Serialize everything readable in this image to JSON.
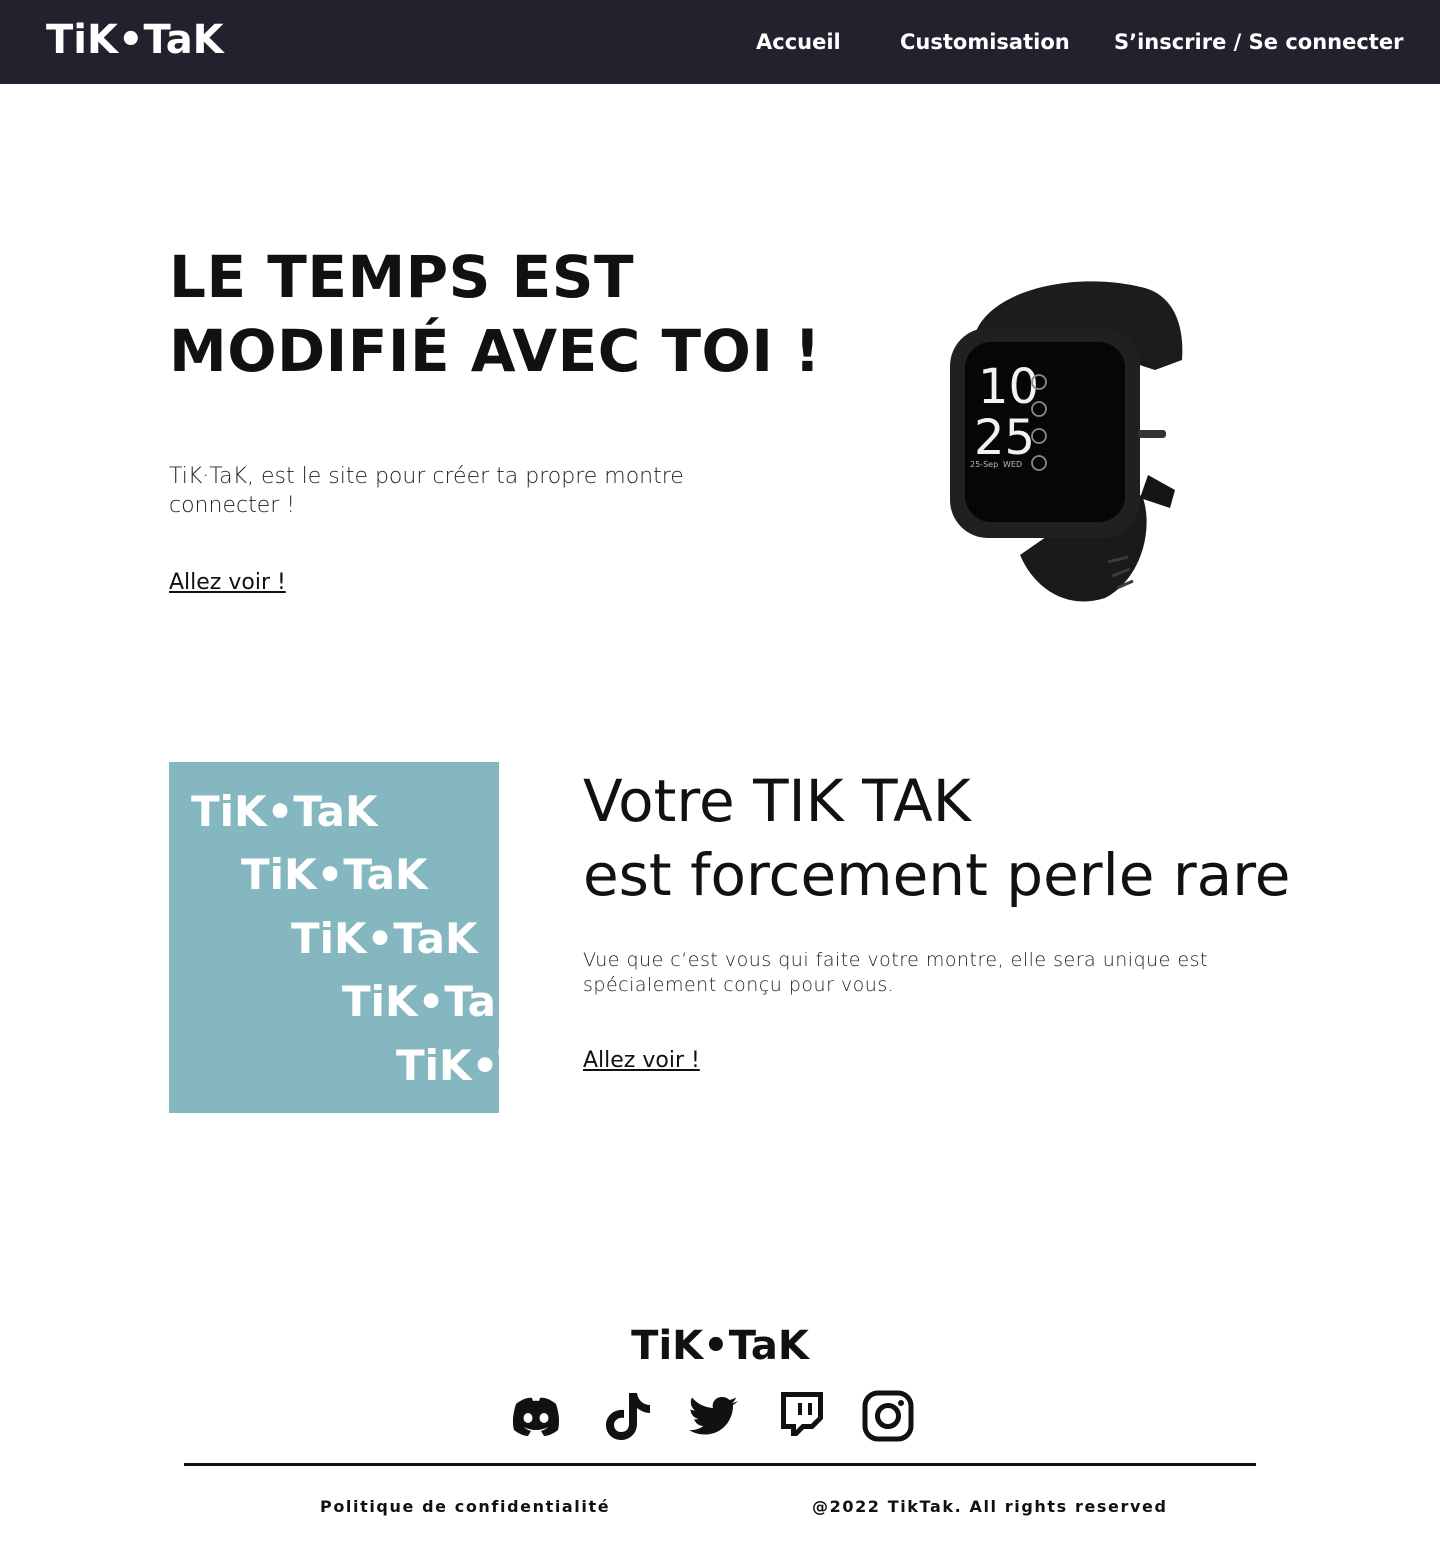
{
  "header": {
    "logo": "TiK•TaK",
    "nav": {
      "home": "Accueil",
      "customisation": "Customisation",
      "account": "S’inscrire / Se connecter"
    }
  },
  "hero": {
    "title": "LE TEMPS EST MODIFIÉ AVEC TOI !",
    "text": "TiK·TaK, est le site pour créer ta propre montre connecter !",
    "link": "Allez voir !",
    "watch": {
      "hour": "10",
      "minute": "25",
      "date": "25-Sep",
      "day": "WED"
    }
  },
  "promo": {
    "repeat_word": "TiK•TaK",
    "background": "#84b7bf",
    "title_line1": "Votre TIK TAK",
    "title_line2": "est forcement perle rare",
    "text": "Vue que c’est vous qui faite votre montre, elle sera unique est spécialement conçu pour vous.",
    "link": "Allez voir !"
  },
  "footer": {
    "logo": "TiK•TaK",
    "social_icons": [
      "discord-icon",
      "tiktok-icon",
      "twitter-icon",
      "twitch-icon",
      "instagram-icon"
    ],
    "policy": "Politique de confidentialité",
    "copyright": "@2022 TikTak. All rights reserved"
  },
  "colors": {
    "navbar": "#22222f",
    "promo": "#84b7bf",
    "text": "#111111"
  }
}
